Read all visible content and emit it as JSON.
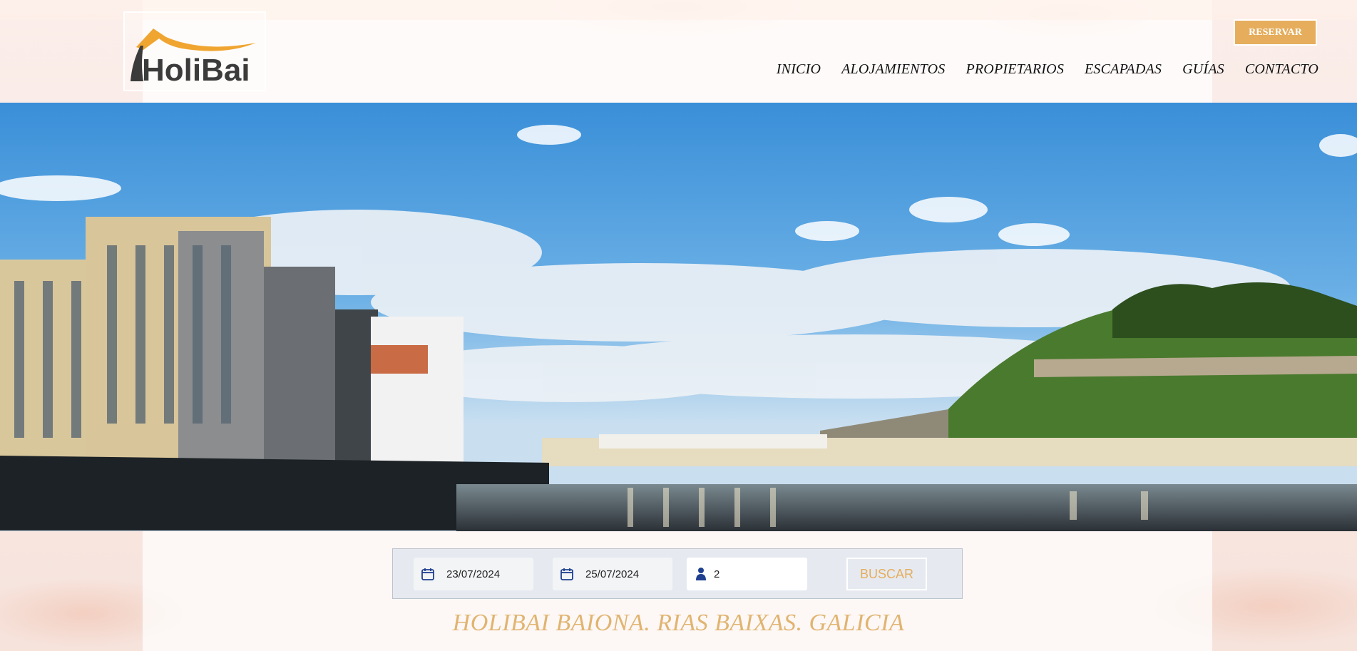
{
  "header": {
    "logo_text": "HoliBai",
    "reserve_label": "RESERVAR",
    "nav": [
      {
        "label": "INICIO"
      },
      {
        "label": "ALOJAMIENTOS"
      },
      {
        "label": "PROPIETARIOS"
      },
      {
        "label": "ESCAPADAS"
      },
      {
        "label": "GUÍAS"
      },
      {
        "label": "CONTACTO"
      }
    ]
  },
  "search": {
    "checkin": "23/07/2024",
    "checkout": "25/07/2024",
    "guests": "2",
    "search_label": "BUSCAR"
  },
  "page": {
    "title": "HOLIBAI BAIONA. RIAS BAIXAS. GALICIA"
  },
  "colors": {
    "accent": "#e5ad5c",
    "title": "#e1b470",
    "icon_blue": "#1f3f8f"
  },
  "icons": {
    "calendar": "calendar-icon",
    "guests": "person-icon"
  }
}
